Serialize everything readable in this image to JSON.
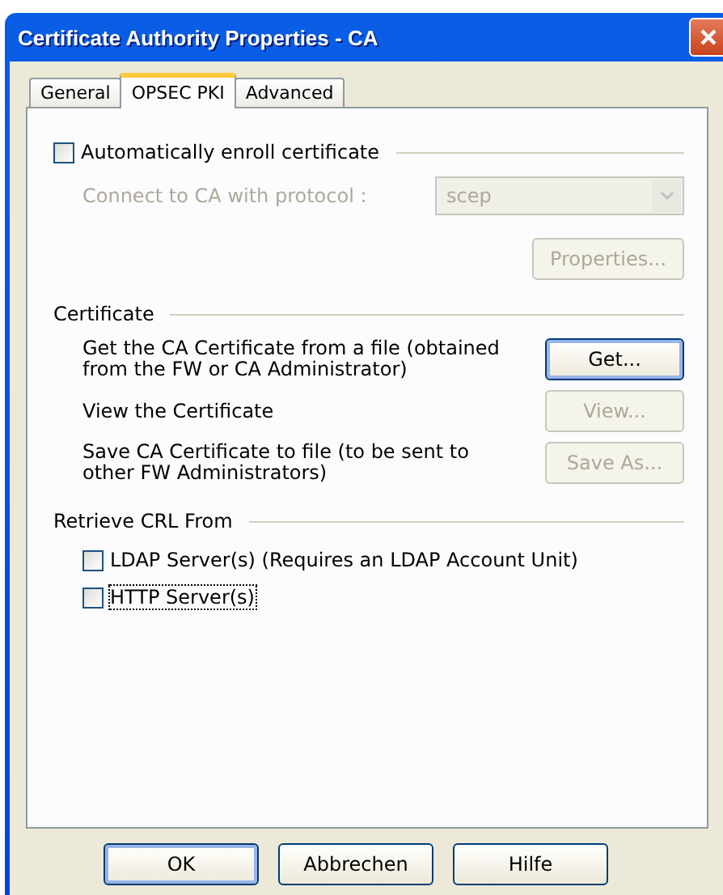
{
  "window": {
    "title": "Certificate Authority Properties - CA"
  },
  "tabs": [
    {
      "label": "General",
      "selected": false
    },
    {
      "label": "OPSEC PKI",
      "selected": true
    },
    {
      "label": "Advanced",
      "selected": false
    }
  ],
  "auto_enroll": {
    "label": "Automatically enroll certificate",
    "checked": false,
    "protocol_label": "Connect to CA with protocol :",
    "protocol_value": "scep",
    "disabled": true,
    "properties_button": {
      "label": "Properties...",
      "disabled": true
    }
  },
  "certificate": {
    "title": "Certificate",
    "rows": [
      {
        "text": "Get the CA Certificate from a file (obtained from the FW or CA Administrator)",
        "button": "Get...",
        "disabled": false,
        "default": true
      },
      {
        "text": "View the Certificate",
        "button": "View...",
        "disabled": true,
        "default": false
      },
      {
        "text": "Save CA Certificate to file (to be sent to other FW Administrators)",
        "button": "Save As...",
        "disabled": true,
        "default": false
      }
    ]
  },
  "crl": {
    "title": "Retrieve CRL From",
    "options": [
      {
        "label": "LDAP Server(s) (Requires an LDAP Account Unit)",
        "checked": false,
        "focused": false
      },
      {
        "label": "HTTP Server(s)",
        "checked": false,
        "focused": true
      }
    ]
  },
  "buttons": [
    {
      "label": "OK",
      "default": true
    },
    {
      "label": "Abbrechen",
      "default": false
    },
    {
      "label": "Hilfe",
      "default": false
    }
  ]
}
